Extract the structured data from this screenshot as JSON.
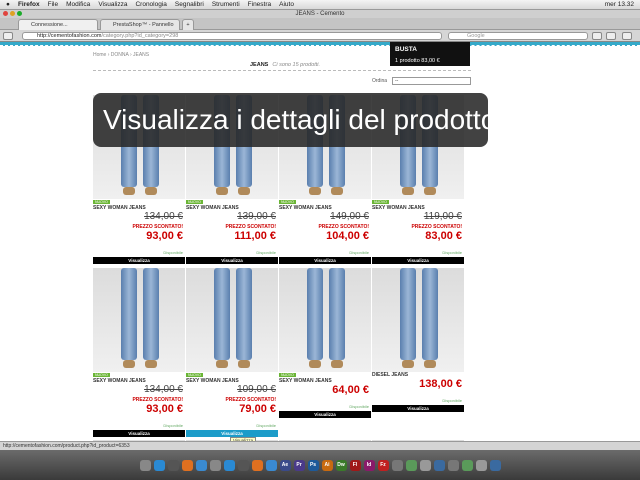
{
  "menubar": {
    "app": "Firefox",
    "items": [
      "File",
      "Modifica",
      "Visualizza",
      "Cronologia",
      "Segnalibri",
      "Strumenti",
      "Finestra",
      "Aiuto"
    ],
    "clock": "mer 13.32"
  },
  "window": {
    "title": "JEANS - Cemento"
  },
  "tabs": [
    {
      "label": "Connessione..."
    },
    {
      "label": "PrestaShop™ - Pannello di amm..."
    }
  ],
  "nav": {
    "url_domain": "http://cementofashion.com",
    "url_path": "/category.php?id_category=298",
    "search_placeholder": "Google"
  },
  "page": {
    "breadcrumb": "Home  ›  DONNA  ›  JEANS",
    "category_title": "JEANS",
    "count_text": "Ci sono 15 prodotti.",
    "cart": {
      "title": "BUSTA",
      "summary": "1 prodotto 83,00 €"
    },
    "sort_label": "Ordina",
    "sort_value": "--",
    "overlay": "Visualizza i dettagli del prodotto",
    "products": [
      {
        "badge": "NUOVO",
        "name": "SEXY WOMAN JEANS",
        "old_price": "134,00 €",
        "promo": "PREZZO SCONTATO!",
        "price": "93,00 €",
        "avail": "Disponibile",
        "button": "Visualizza"
      },
      {
        "badge": "NUOVO",
        "name": "SEXY WOMAN JEANS",
        "old_price": "139,00 €",
        "promo": "PREZZO SCONTATO!",
        "price": "111,00 €",
        "avail": "Disponibile",
        "button": "Visualizza"
      },
      {
        "badge": "NUOVO",
        "name": "SEXY WOMAN JEANS",
        "old_price": "149,00 €",
        "promo": "PREZZO SCONTATO!",
        "price": "104,00 €",
        "avail": "Disponibile",
        "button": "Visualizza"
      },
      {
        "badge": "NUOVO",
        "name": "SEXY WOMAN JEANS",
        "old_price": "119,00 €",
        "promo": "PREZZO SCONTATO!",
        "price": "83,00 €",
        "avail": "Disponibile",
        "button": "Visualizza"
      },
      {
        "badge": "NUOVO",
        "name": "SEXY WOMAN JEANS",
        "old_price": "134,00 €",
        "promo": "PREZZO SCONTATO!",
        "price": "93,00 €",
        "avail": "Disponibile",
        "button": "Visualizza"
      },
      {
        "badge": "NUOVO",
        "name": "SEXY WOMAN JEANS",
        "old_price": "109,00 €",
        "promo": "PREZZO SCONTATO!",
        "price": "79,00 €",
        "avail": "Disponibile",
        "button": "Visualizza"
      },
      {
        "badge": "NUOVO",
        "name": "SEXY WOMAN JEANS",
        "price": "64,00 €",
        "avail": "Disponibile",
        "button": "Visualizza"
      },
      {
        "name": "DIESEL JEANS",
        "price": "138,00 €",
        "avail": "Disponibile",
        "button": "Visualizza"
      }
    ],
    "tooltip": "Visualizza"
  },
  "status": "http://cementofashion.com/product.php?id_product=6353",
  "dock": [
    "Ae",
    "Pr",
    "Ps",
    "Ai",
    "Dw",
    "Fl",
    "Id",
    "Fz"
  ]
}
